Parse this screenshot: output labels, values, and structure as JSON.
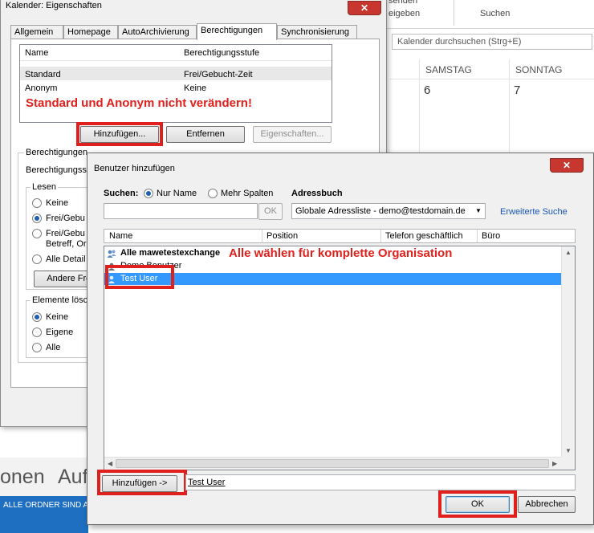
{
  "background": {
    "ribbon_top": "senden",
    "ribbon_share": "eigeben",
    "ribbon_search": "Suchen",
    "search_placeholder": "Kalender durchsuchen (Strg+E)",
    "day_headers": [
      "SAMSTAG",
      "SONNTAG"
    ],
    "day_numbers": [
      "6",
      "7"
    ],
    "bottom_text_1": "onen",
    "bottom_text_2": "Auf",
    "status_text": "ALLE ORDNER SIND A"
  },
  "properties_dialog": {
    "title": "Kalender: Eigenschaften",
    "close_label": "✕",
    "tabs": [
      "Allgemein",
      "Homepage",
      "AutoArchivierung",
      "Berechtigungen",
      "Synchronisierung"
    ],
    "active_tab": "Berechtigungen",
    "permissions_table": {
      "headers": [
        "Name",
        "Berechtigungsstufe"
      ],
      "rows": [
        {
          "name": "Standard",
          "level": "Frei/Gebucht-Zeit"
        },
        {
          "name": "Anonym",
          "level": "Keine"
        }
      ]
    },
    "annotation": "Standard und Anonym nicht verändern!",
    "buttons": {
      "add": "Hinzufügen...",
      "remove": "Entfernen",
      "properties": "Eigenschaften..."
    },
    "permissions_group_label": "Berechtigungen",
    "permissions_level_label": "Berechtigungss",
    "read_group": {
      "title": "Lesen",
      "options": [
        "Keine",
        "Frei/Gebu",
        "Frei/Gebu",
        "Alle Detail"
      ],
      "option3_line2": "Betreff, Or",
      "selected": 1
    },
    "other_button": "Andere Frei",
    "delete_group": {
      "title": "Elemente lösc",
      "options": [
        "Keine",
        "Eigene",
        "Alle"
      ],
      "selected": 0
    }
  },
  "add_user_dialog": {
    "title": "Benutzer hinzufügen",
    "close_label": "✕",
    "search_label": "Suchen:",
    "search_options": [
      "Nur Name",
      "Mehr Spalten"
    ],
    "search_selected": 0,
    "search_value": "",
    "ok_small": "OK",
    "address_book_label": "Adressbuch",
    "address_book_value": "Globale Adressliste - demo@testdomain.de",
    "advanced_search": "Erweiterte Suche",
    "columns": [
      "Name",
      "Position",
      "Telefon geschäftlich",
      "Büro"
    ],
    "entries": [
      {
        "name": "Alle mawetestexchange",
        "bold": true,
        "icon": "group-icon"
      },
      {
        "name": "Demo Benutzer",
        "bold": false,
        "icon": "user-icon"
      },
      {
        "name": "Test User",
        "bold": false,
        "icon": "user-icon",
        "selected": true
      }
    ],
    "annotation": "Alle wählen für komplette Organisation",
    "add_button": "Hinzufügen ->",
    "added_value": "Test User",
    "ok_button": "OK",
    "cancel_button": "Abbrechen"
  },
  "colors": {
    "annotation_red": "#e0201c",
    "selection_blue": "#3399ff",
    "close_red": "#c7362f",
    "status_blue": "#1e6fc1"
  }
}
